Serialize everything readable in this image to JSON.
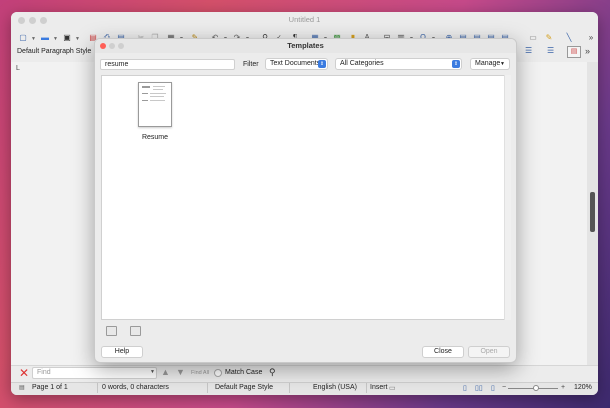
{
  "writer": {
    "window_title": "Untitled 1",
    "paragraph_style": "Default Paragraph Style",
    "ruler_mark": "L"
  },
  "find_bar": {
    "placeholder": "Find",
    "find_all": "Find All",
    "match_case": "Match Case"
  },
  "status_bar": {
    "page": "Page 1 of 1",
    "words": "0 words, 0 characters",
    "page_style": "Default Page Style",
    "language": "English (USA)",
    "insert_mode": "Insert",
    "zoom": "120%"
  },
  "dialog": {
    "title": "Templates",
    "search_value": "resume",
    "filter_label": "Filter",
    "filter_value": "Text Documents",
    "category_value": "All Categories",
    "manage_label": "Manage",
    "templates": [
      {
        "name": "Resume"
      }
    ],
    "help_label": "Help",
    "close_label": "Close",
    "open_label": "Open"
  },
  "colors": {
    "accent": "#3a7be0",
    "close_red": "#ff5f57"
  }
}
